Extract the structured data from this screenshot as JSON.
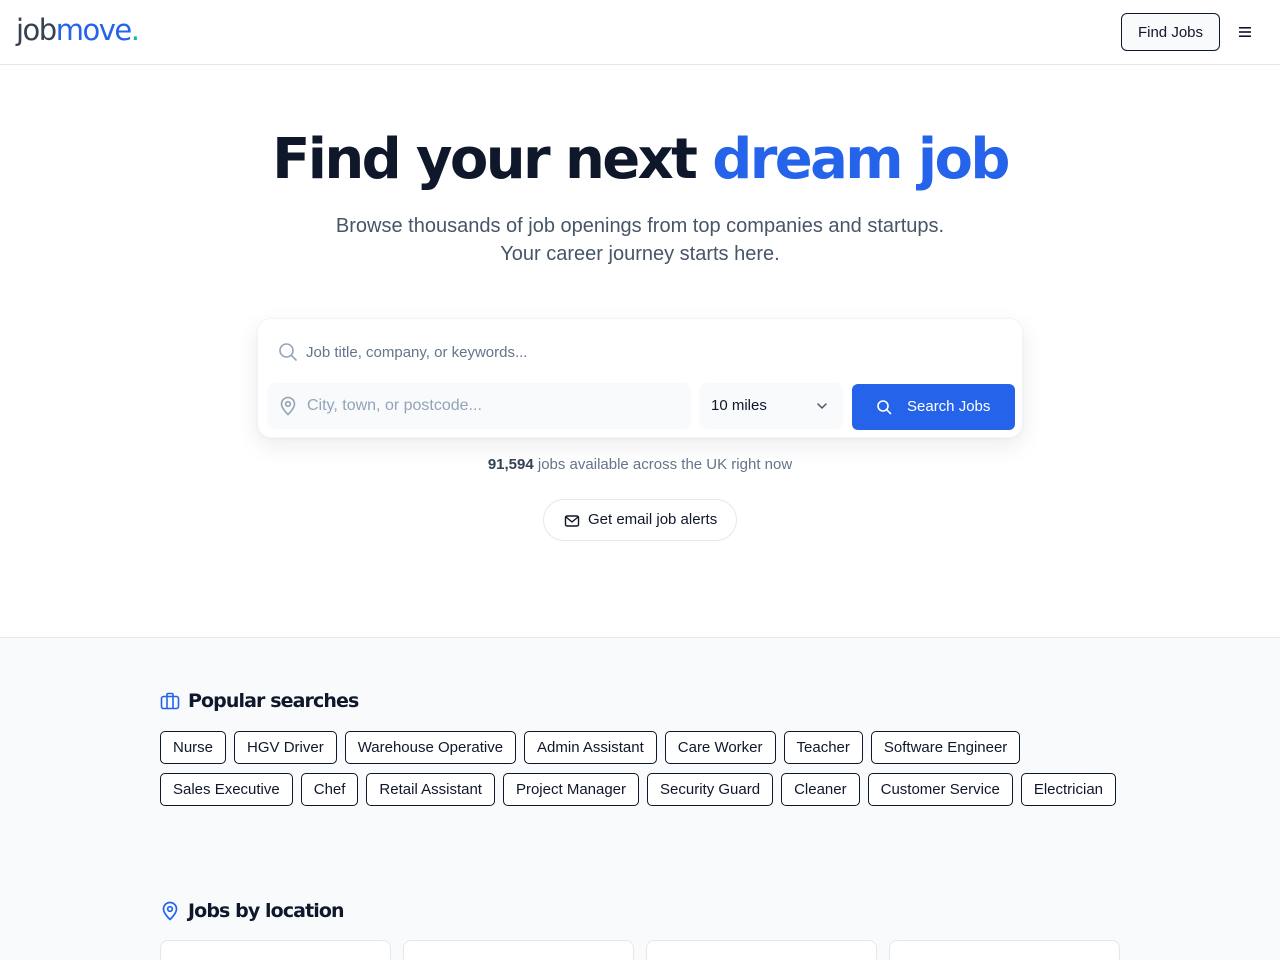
{
  "header": {
    "logo": {
      "part1": "job",
      "part2": "move",
      "part3": "."
    },
    "find_jobs_label": "Find Jobs",
    "menu_icon": "hamburger-menu-icon"
  },
  "hero": {
    "title_main": "Find your next ",
    "title_accent": "dream job",
    "subtitle_line1": "Browse thousands of job openings from top companies and startups.",
    "subtitle_line2": "Your career journey starts here."
  },
  "search": {
    "keyword_placeholder": "Job title, company, or keywords...",
    "keyword_value": "",
    "location_placeholder": "City, town, or postcode...",
    "location_value": "",
    "radius_value": "10 miles",
    "search_button_label": "Search Jobs"
  },
  "jobs_count": {
    "number": "91,594",
    "suffix": " jobs available across the UK right now"
  },
  "alerts_button_label": "Get email job alerts",
  "popular": {
    "heading": "Popular searches",
    "items": [
      "Nurse",
      "HGV Driver",
      "Warehouse Operative",
      "Admin Assistant",
      "Care Worker",
      "Teacher",
      "Software Engineer",
      "Sales Executive",
      "Chef",
      "Retail Assistant",
      "Project Manager",
      "Security Guard",
      "Cleaner",
      "Customer Service",
      "Electrician"
    ]
  },
  "locations": {
    "heading": "Jobs by location"
  },
  "colors": {
    "brand": "#2563eb",
    "heading": "#0f172a",
    "muted": "#64748b",
    "section_bg": "#f8fafc"
  }
}
